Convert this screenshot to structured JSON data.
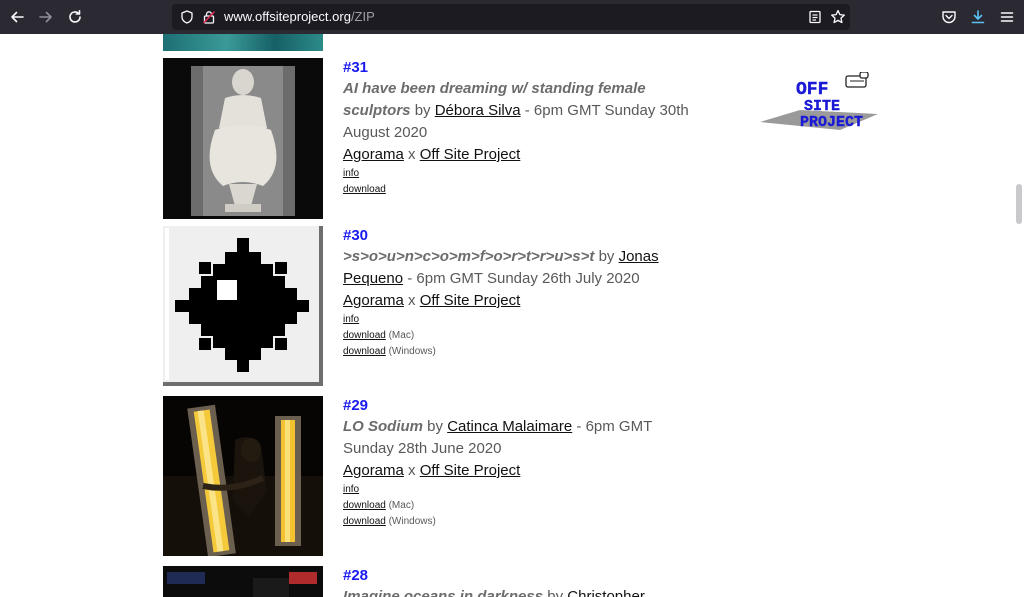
{
  "browser": {
    "url_domain": "www.offsiteproject.org",
    "url_path": "/ZIP"
  },
  "colors": {
    "toolbar": "#2b2a33",
    "urlbar": "#1c1b22",
    "entry_number": "#1a1af0",
    "body_text": "#595959",
    "download_icon": "#5bc2f5"
  },
  "logo": {
    "line1": "OFF",
    "line2": "SITE",
    "line3": "PROJECT"
  },
  "entries": [
    {
      "number": "#31",
      "title": "AI have been dreaming w/ standing female sculptors",
      "by": "by",
      "artist": "Débora Silva",
      "time": "- 6pm GMT Sunday 30th August 2020",
      "partner1": "Agorama",
      "x": "x",
      "partner2": "Off Site Project",
      "info": "info",
      "downloads": [
        {
          "label": "download",
          "platform": ""
        }
      ]
    },
    {
      "number": "#30",
      "title": ">s>o>u>n>c>o>m>f>o>r>t>r>u>s>t",
      "by": "by",
      "artist": "Jonas Pequeno",
      "time": "- 6pm GMT Sunday 26th July 2020",
      "partner1": "Agorama",
      "x": "x",
      "partner2": "Off Site Project",
      "info": "info",
      "downloads": [
        {
          "label": "download",
          "platform": "(Mac)"
        },
        {
          "label": "download",
          "platform": "(Windows)"
        }
      ]
    },
    {
      "number": "#29",
      "title": "LO Sodium",
      "by": "by",
      "artist": "Catinca Malaimare",
      "time": "- 6pm GMT Sunday 28th June 2020",
      "partner1": "Agorama",
      "x": "x",
      "partner2": "Off Site Project",
      "info": "info",
      "downloads": [
        {
          "label": "download",
          "platform": "(Mac)"
        },
        {
          "label": "download",
          "platform": "(Windows)"
        }
      ]
    },
    {
      "number": "#28",
      "title": "Imagine oceans in darkness",
      "by": "by",
      "artist": "Christopher"
    }
  ]
}
